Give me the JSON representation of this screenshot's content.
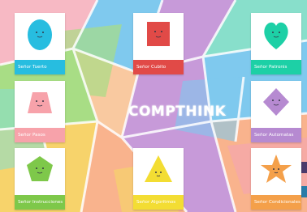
{
  "app": {
    "title": "COMPTHINK"
  },
  "colors": {
    "tuerto": "#27bde0",
    "cubito": "#e14a47",
    "patronis": "#1dd0a6",
    "pasos": "#f7a2aa",
    "automatas": "#b68ad1",
    "instrucciones": "#7ec84a",
    "algoritmos": "#f3dd33",
    "condicionales": "#f4a04a"
  },
  "cards": [
    {
      "id": "tuerto",
      "label": "Señor Tuerto",
      "icon": "oval-character-icon"
    },
    {
      "id": "cubito",
      "label": "Señor Cubito",
      "icon": "square-character-icon"
    },
    {
      "id": "patronis",
      "label": "Señor Patronis",
      "icon": "heart-character-icon"
    },
    {
      "id": "pasos",
      "label": "Señor Pasos",
      "icon": "trapezoid-character-icon"
    },
    {
      "id": "automatas",
      "label": "Señor Automatas",
      "icon": "diamond-character-icon"
    },
    {
      "id": "instrucciones",
      "label": "Señor Instrucciones",
      "icon": "pentagon-character-icon"
    },
    {
      "id": "algoritmos",
      "label": "Señor Algoritmos",
      "icon": "triangle-character-icon"
    },
    {
      "id": "condicionales",
      "label": "Señor Condicionales",
      "icon": "star-character-icon"
    }
  ]
}
